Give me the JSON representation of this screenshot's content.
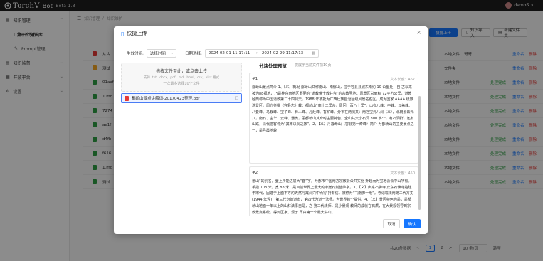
{
  "app": {
    "title": "TorchV",
    "suffix": "Bot",
    "beta": "Beta 1.3",
    "user": "demoБ"
  },
  "sidebar": {
    "items": [
      {
        "label": "知识管理"
      },
      {
        "label": "知识维护"
      },
      {
        "label": "Prompt管理"
      },
      {
        "label": "知识监督"
      },
      {
        "label": "开放平台"
      },
      {
        "label": "设置"
      }
    ]
  },
  "breadcrumb": {
    "a": "知识管理",
    "sep": "/",
    "b": "知识维护"
  },
  "main": {
    "title": "第一个知识库",
    "buttons": {
      "upload": "快捷上传",
      "import": "知识导入",
      "newfolder": "新建文件夹"
    },
    "rows": [
      {
        "name": "从古",
        "type": "本地文件",
        "source": "哥哥",
        "status": "",
        "a1": "重命名",
        "a2": "删除"
      },
      {
        "name": "测试",
        "type": "文件夹",
        "source": "–",
        "status": "",
        "a1": "重命名",
        "a2": "删除"
      },
      {
        "name": "01aaf",
        "type": "本地文件",
        "source": "",
        "status": "处理完成",
        "a1": "重命名",
        "a2": "删除"
      },
      {
        "name": "1.md",
        "type": "本地文件",
        "source": "",
        "status": "处理完成",
        "a1": "重命名",
        "a2": "删除"
      },
      {
        "name": "7274",
        "type": "本地文件",
        "source": "",
        "status": "处理完成",
        "a1": "重命名",
        "a2": "删除"
      },
      {
        "name": "ae1f",
        "type": "本地文件",
        "source": "",
        "status": "处理完成",
        "a1": "重命名",
        "a2": "删除"
      },
      {
        "name": "d4fb",
        "type": "本地文件",
        "source": "",
        "status": "处理完成",
        "a1": "重命名",
        "a2": "删除"
      },
      {
        "name": "f616",
        "type": "本地文件",
        "source": "",
        "status": "处理完成",
        "a1": "重命名",
        "a2": "删除"
      },
      {
        "name": "1.md",
        "type": "本地文件",
        "source": "",
        "status": "处理完成",
        "a1": "重命名",
        "a2": "删除"
      },
      {
        "name": "测试",
        "type": "本地文件",
        "source": "",
        "status": "处理完成",
        "a1": "重命名",
        "a2": "删除"
      }
    ],
    "pagination": {
      "total": "共20条数据",
      "prev": "<",
      "p1": "1",
      "p2": "2",
      "next": ">",
      "size": "10 条/页",
      "jump": "跳至"
    }
  },
  "modal": {
    "title": "快捷上传",
    "close": "×",
    "filter": {
      "time_label": "生效时间:",
      "time_value": "选择时间",
      "date_label": "日期选择:",
      "date_start": "2024-02-01 11:17:11",
      "date_sep": "→",
      "date_end": "2024-02-29 11:17:13"
    },
    "drop": {
      "title": "拖拽文件至此，或点击上传",
      "types": "支持 .txt, .docx, .pdf, .md, .html, .csv, .xlsx 格式",
      "limit": "一次最多选择10个文件"
    },
    "file": {
      "name": "都峤山景点讲解词-20170423整理.pdf"
    },
    "preview": {
      "title": "分块处理预览",
      "subtitle": "仅展示当前文件前10页"
    },
    "chunks": [
      {
        "index": "#1",
        "count": "文本长度：467",
        "text": "都峤山景点简介 1、【义】概况 都峤山又称南山、南郁山，位于容县县城东南约 10 公里处，自 古以来被为88福地，乃是桂东南地区重要的“道教佛士教并容”的宗教圣地。风景区总面积 72平方公里，道教经典称为中国道教第二十四洞天，1988 年被批为广西壮族自治区级风景名胜区，成为国家 AAAA 级旅游景区。周光尧撰《容县志》载：都峤山“高十二里余，周回一百八十里”。山有八峰：中峰、云盖峰、八叠峰、马鞍峰、宝子峰、狮人峰、丹灶峰、香炉峰。分布在两侧又：南宫宝元八洞（义），北岗那紫元八，南石、宝华、云峰、通微，思都峤山其奇时主要特色，全山共大小石洞 300 多个，有石洞群，还有山路，清代游客称为“其南以洞之数”。2、【义】丹霞命山（容县第一奇峰）简介 为都峤山的主要景点之一，是丹霞地貌"
      },
      {
        "index": "#2",
        "count": "文本长度：450",
        "text": "道山”的别名，登上所能进层大“菩”字，为都市中国南方宗教会公共实处 升起而为宝地会会中山所有。手指 108 米，宽 88 米，是目前世界上最大的摩崖石刻菩萨字。3、【义】庆东石佛寺 庆东石佛寺始建于宋代，因建于上面下方的天然丹霞洞穴中而得 持有信。被称为“飞南佛一绝”。寺记载法南第二代方丈(1944 年涅)：第三代为德道宏，第四代为道一法师。为世界首个提供。4、【义】景区特色为是，是都峤山地面一年以上的山林法事自是，之 第二代法师，是小景观 教师的成就在石质，在大景观领导到宗教景点系统。得到区家、规于 再由第一个最大书山。"
      }
    ],
    "buttons": {
      "cancel": "取消",
      "ok": "确认"
    }
  },
  "colors": {
    "brand": "#1677ff",
    "danger": "#e53935",
    "success": "#2e9e44",
    "topbar": "#1e1e1e"
  }
}
